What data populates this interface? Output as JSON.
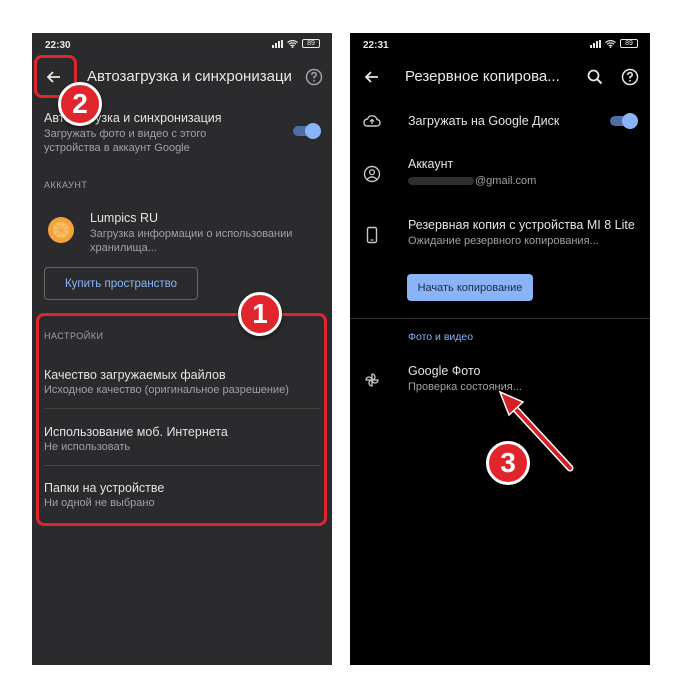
{
  "left_screen": {
    "status": {
      "time": "22:30",
      "battery": "89"
    },
    "title": "Автозагрузка и синхронизация",
    "sync": {
      "title": "Автозагрузка и синхронизация",
      "subtitle_line1": "Загружать фото и видео с этого",
      "subtitle_line2": "устройства в аккаунт Google"
    },
    "account_section": "АККАУНТ",
    "account": {
      "name": "Lumpics RU",
      "line1": "Загрузка информации о использовании",
      "line2": "хранилища..."
    },
    "buy_button": "Купить пространство",
    "settings_section": "НАСТРОЙКИ",
    "settings": [
      {
        "title": "Качество загружаемых файлов",
        "value": "Исходное качество (оригинальное разрешение)"
      },
      {
        "title": "Использование моб. Интернета",
        "value": "Не использовать"
      },
      {
        "title": "Папки на устройстве",
        "value": "Ни одной не выбрано"
      }
    ]
  },
  "right_screen": {
    "status": {
      "time": "22:31",
      "battery": "89"
    },
    "title": "Резервное копирова...",
    "drive_upload": "Загружать на Google Диск",
    "account": {
      "title": "Аккаунт",
      "email": "@gmail.com"
    },
    "backup": {
      "title": "Резервная копия с устройства MI 8 Lite",
      "subtitle": "Ожидание резервного копирования..."
    },
    "start_button": "Начать копирование",
    "photos_section": "Фото и видео",
    "photos": {
      "title": "Google Фото",
      "subtitle": "Проверка состояния..."
    }
  },
  "annotations": {
    "badge1": "1",
    "badge2": "2",
    "badge3": "3"
  },
  "colors": {
    "accent": "#8ab4f8",
    "annotation_red": "#e0252d",
    "left_bg": "#2b2b2d",
    "right_bg": "#000000"
  }
}
